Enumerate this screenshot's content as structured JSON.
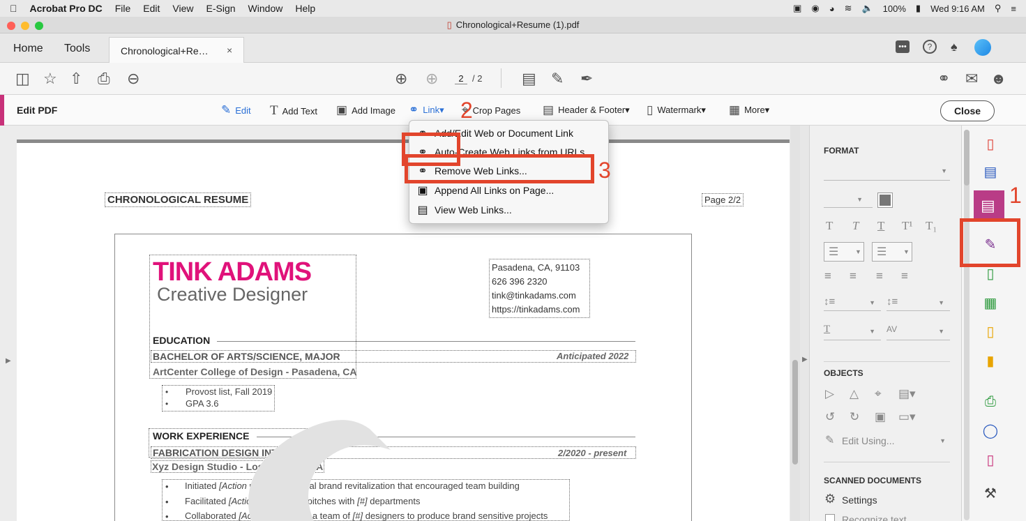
{
  "menubar": {
    "app_name": "Acrobat Pro DC",
    "items": [
      "File",
      "Edit",
      "View",
      "E-Sign",
      "Window",
      "Help"
    ],
    "battery": "100%",
    "clock": "Wed 9:16 AM"
  },
  "window": {
    "title": "Chronological+Resume (1).pdf"
  },
  "tabs": {
    "home": "Home",
    "tools": "Tools",
    "document": "Chronological+Re…",
    "close_glyph": "×"
  },
  "toolbar": {
    "page_current": "2",
    "page_total": "/ 2"
  },
  "editbar": {
    "title": "Edit PDF",
    "tools": [
      {
        "label": "Edit",
        "icon": "edit-icon"
      },
      {
        "label": "Add Text",
        "icon": "add-text-icon"
      },
      {
        "label": "Add Image",
        "icon": "add-image-icon"
      },
      {
        "label": "Link▾",
        "icon": "link-icon"
      },
      {
        "label": "Crop Pages",
        "icon": "crop-icon"
      },
      {
        "label": "Header & Footer▾",
        "icon": "header-footer-icon"
      },
      {
        "label": "Watermark▾",
        "icon": "watermark-icon"
      },
      {
        "label": "More▾",
        "icon": "more-icon"
      }
    ],
    "close_label": "Close"
  },
  "link_menu": {
    "items": [
      {
        "label": "Add/Edit Web or Document Link",
        "icon": "link-edit-icon"
      },
      {
        "label": "Auto-Create Web Links from URLs",
        "icon": "link-auto-icon"
      },
      {
        "label": "Remove Web Links...",
        "icon": "link-remove-icon"
      },
      {
        "label": "Append All Links on Page...",
        "icon": "link-append-icon"
      },
      {
        "label": "View Web Links...",
        "icon": "link-view-icon"
      }
    ]
  },
  "annotations": {
    "step1": "1",
    "step2": "2",
    "step3": "3",
    "color": "#e2452c"
  },
  "document": {
    "header_left": "CHRONOLOGICAL RESUME",
    "header_right": "Page 2/2",
    "name": "TINK ADAMS",
    "role": "Creative Designer",
    "name_color": "#e0127a",
    "contact": [
      "Pasadena, CA, 91103",
      "626 396 2320",
      "tink@tinkadams.com",
      "https://tinkadams.com"
    ],
    "education_heading": "EDUCATION",
    "degree": "BACHELOR OF ARTS/SCIENCE, MAJOR",
    "school": "ArtCenter College of Design - Pasadena, CA",
    "grad_date": "Anticipated 2022",
    "edu_bullets": [
      "Provost list, Fall 2019",
      "GPA 3.6"
    ],
    "work_heading": "WORK EXPERIENCE",
    "job_title": "FABRICATION DESIGN INTERN",
    "company": "Xyz Design Studio - Los Angeles, CA",
    "job_date": "2/2020 - present",
    "work_bullets": [
      [
        "Initiated ",
        "[Action word]",
        " an internal brand revitalization that encouraged team building"
      ],
      [
        "Facilitated ",
        "[Action word]",
        " client pitches with ",
        "[#]",
        " departments"
      ],
      [
        "Collaborated ",
        "[Action word]",
        " with a team of ",
        "[#]",
        " designers to produce brand sensitive projects"
      ]
    ]
  },
  "format_panel": {
    "format_heading": "FORMAT",
    "objects_heading": "OBJECTS",
    "edit_using": "Edit Using...",
    "scanned_heading": "SCANNED DOCUMENTS",
    "settings": "Settings",
    "recognize": "Recognize text"
  }
}
